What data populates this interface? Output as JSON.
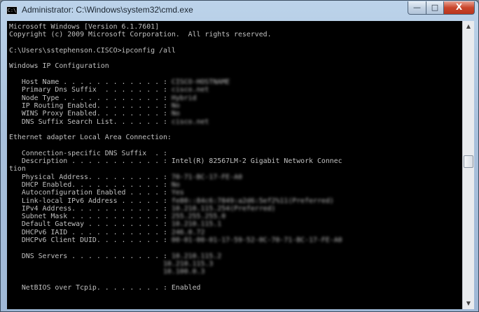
{
  "window": {
    "title": "Administrator: C:\\Windows\\system32\\cmd.exe",
    "icon": "cmd-icon",
    "icon_text": "C:\\",
    "controls": {
      "minimize": "—",
      "maximize": "□",
      "close": "X"
    }
  },
  "console": {
    "lines": [
      "Microsoft Windows [Version 6.1.7601]",
      "Copyright (c) 2009 Microsoft Corporation.  All rights reserved.",
      "",
      "C:\\Users\\sstephenson.CISCO>ipconfig /all",
      "",
      "Windows IP Configuration",
      "",
      "   Host Name . . . . . . . . . . . . : ",
      "   Primary Dns Suffix  . . . . . . . : ",
      "   Node Type . . . . . . . . . . . . : ",
      "   IP Routing Enabled. . . . . . . . : ",
      "   WINS Proxy Enabled. . . . . . . . : ",
      "   DNS Suffix Search List. . . . . . : ",
      "",
      "Ethernet adapter Local Area Connection:",
      "",
      "   Connection-specific DNS Suffix  . :",
      "   Description . . . . . . . . . . . : Intel(R) 82567LM-2 Gigabit Network Connec",
      "tion",
      "   Physical Address. . . . . . . . . : ",
      "   DHCP Enabled. . . . . . . . . . . : ",
      "   Autoconfiguration Enabled . . . . : ",
      "   Link-local IPv6 Address . . . . . : ",
      "   IPv4 Address. . . . . . . . . . . : ",
      "   Subnet Mask . . . . . . . . . . . : ",
      "   Default Gateway . . . . . . . . . : ",
      "   DHCPv6 IAID . . . . . . . . . . . : ",
      "   DHCPv6 Client DUID. . . . . . . . : ",
      "",
      "   DNS Servers . . . . . . . . . . . : ",
      "",
      "",
      "",
      "   NetBIOS over Tcpip. . . . . . . . : Enabled"
    ],
    "blurred_values": {
      "host_name": "CISCO-HOSTNAME",
      "primary_dns_suffix": "cisco.net",
      "node_type": "Hybrid",
      "ip_routing": "No",
      "wins_proxy": "No",
      "dns_suffix_search": "cisco.net",
      "physical_address": "70-71-BC-17-FE-A0",
      "dhcp_enabled": "No",
      "autoconfiguration": "Yes",
      "link_local_ipv6": "fe80::84c6:7849:a2d6:5ef2%11(Preferred)",
      "ipv4": "10.210.115.254(Preferred)",
      "subnet_mask": "255.255.255.0",
      "default_gateway": "10.210.115.1",
      "dhcpv6_iaid": "246.0.72",
      "dhcpv6_duid": "00-01-00-01-17-59-52-0C-70-71-BC-17-FE-A0",
      "dns_servers": [
        "10.210.115.2",
        "10.210.115.3",
        "10.100.0.3"
      ]
    }
  }
}
